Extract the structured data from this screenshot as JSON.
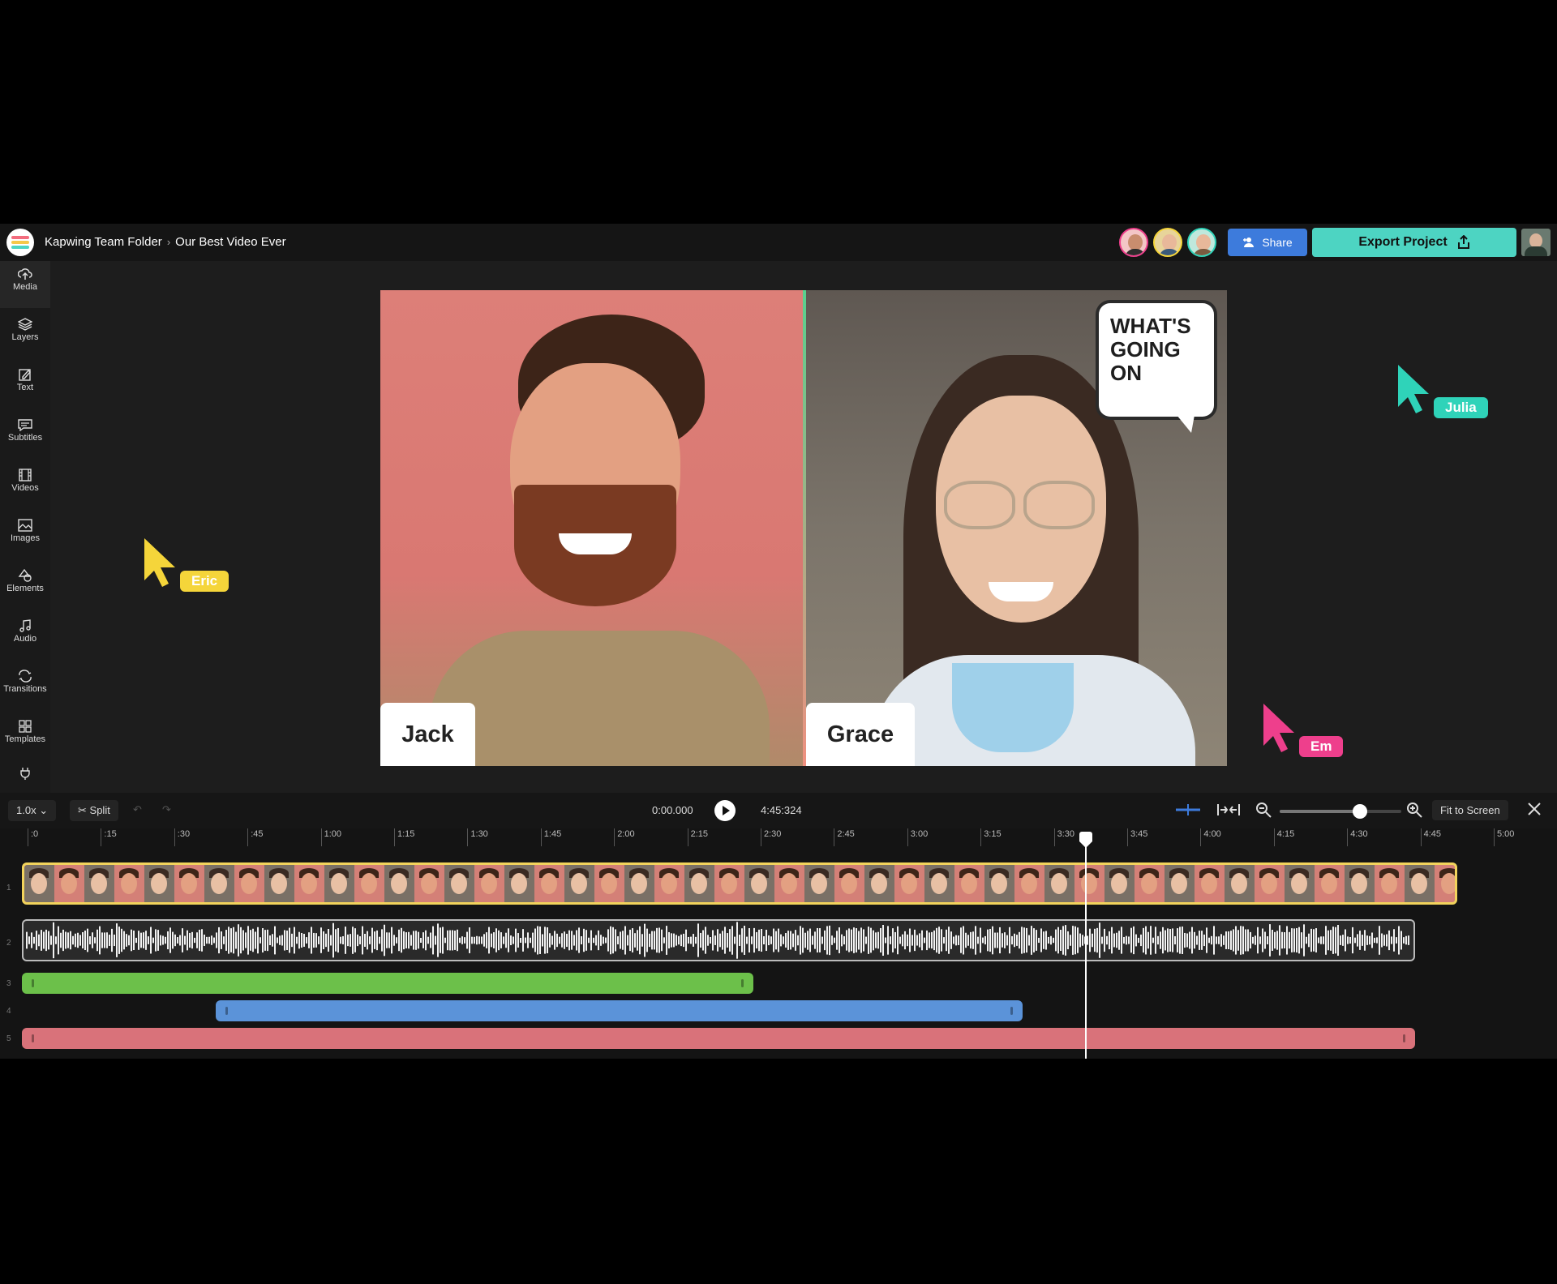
{
  "header": {
    "folder": "Kapwing Team Folder",
    "separator": "›",
    "project_title": "Our Best Video Ever",
    "share_label": "Share",
    "export_label": "Export Project"
  },
  "sidebar": {
    "items": [
      {
        "label": "Media",
        "icon": "upload-cloud-icon"
      },
      {
        "label": "Layers",
        "icon": "layers-icon"
      },
      {
        "label": "Text",
        "icon": "pencil-icon"
      },
      {
        "label": "Subtitles",
        "icon": "subtitles-icon"
      },
      {
        "label": "Videos",
        "icon": "film-icon"
      },
      {
        "label": "Images",
        "icon": "image-icon"
      },
      {
        "label": "Elements",
        "icon": "shapes-icon"
      },
      {
        "label": "Audio",
        "icon": "music-note-icon"
      },
      {
        "label": "Transitions",
        "icon": "transition-icon"
      },
      {
        "label": "Templates",
        "icon": "grid-icon"
      }
    ]
  },
  "canvas": {
    "left_name": "Jack",
    "right_name": "Grace",
    "bubble_text": [
      "WHAT'S",
      "GOING",
      "ON"
    ],
    "cursors": [
      {
        "name": "Eric",
        "color": "#f5d53a"
      },
      {
        "name": "Julia",
        "color": "#2fd3b9"
      },
      {
        "name": "Em",
        "color": "#ee3f8c"
      }
    ]
  },
  "timeline": {
    "speed": "1.0x",
    "split_label": "Split",
    "current_time": "0:00.000",
    "duration": "4:45:324",
    "fit_label": "Fit to Screen",
    "zoom_level": 0.66,
    "ruler": [
      ":0",
      ":15",
      ":30",
      ":45",
      "1:00",
      "1:15",
      "1:30",
      "1:45",
      "2:00",
      "2:15",
      "2:30",
      "2:45",
      "3:00",
      "3:15",
      "3:30",
      "3:45",
      "4:00",
      "4:15",
      "4:30",
      "4:45",
      "5:00"
    ],
    "track_numbers": [
      "1",
      "2",
      "3",
      "4",
      "5"
    ],
    "track_colors": {
      "video_border": "#f2d35c",
      "green": "#6cc04a",
      "blue": "#5b93d9",
      "red": "#d9727a"
    }
  },
  "colors": {
    "accent_teal": "#4dd4c2",
    "accent_blue": "#3d7bdc"
  }
}
